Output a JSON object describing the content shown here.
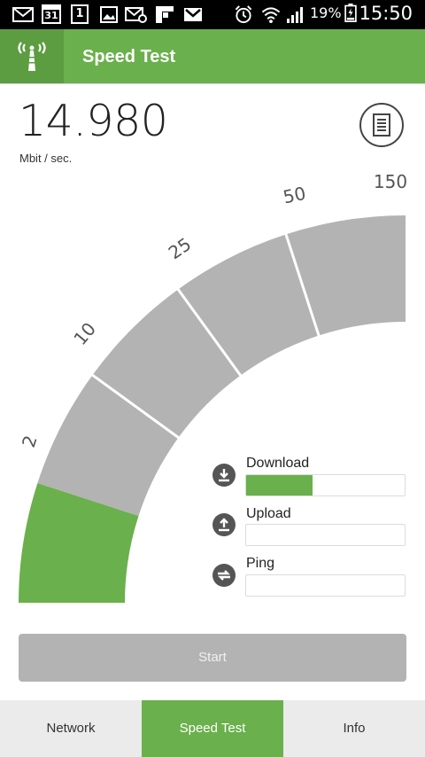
{
  "status_bar": {
    "calendar_day": "31",
    "calendar_small": "1",
    "battery": "19%",
    "time": "15:50",
    "icons": [
      "mail-icon",
      "calendar-icon",
      "calendar-small-icon",
      "image-icon",
      "mail-settings-icon",
      "flipboard-icon",
      "gmail-icon",
      "alarm-icon",
      "wifi-icon",
      "signal-icon",
      "battery-icon"
    ]
  },
  "app_bar": {
    "title": "Speed Test",
    "icon": "antenna-icon"
  },
  "speed": {
    "value": "14.980",
    "unit": "Mbit / sec."
  },
  "gauge": {
    "tick_labels": [
      "2",
      "10",
      "25",
      "50",
      "150"
    ],
    "fill_segments": 1,
    "total_segments": 5,
    "active_color": "#6ab04c",
    "inactive_color": "#b3b3b3"
  },
  "metrics": [
    {
      "label": "Download",
      "progress": 0.42,
      "icon": "download-icon"
    },
    {
      "label": "Upload",
      "progress": 0,
      "icon": "upload-icon"
    },
    {
      "label": "Ping",
      "progress": 0,
      "icon": "ping-icon"
    }
  ],
  "start_button": {
    "label": "Start"
  },
  "bottom_nav": {
    "tabs": [
      {
        "label": "Network",
        "active": false
      },
      {
        "label": "Speed Test",
        "active": true
      },
      {
        "label": "Info",
        "active": false
      }
    ]
  },
  "colors": {
    "accent": "#6ab04c",
    "accent_dark": "#5c9d41",
    "inactive": "#b3b3b3"
  }
}
